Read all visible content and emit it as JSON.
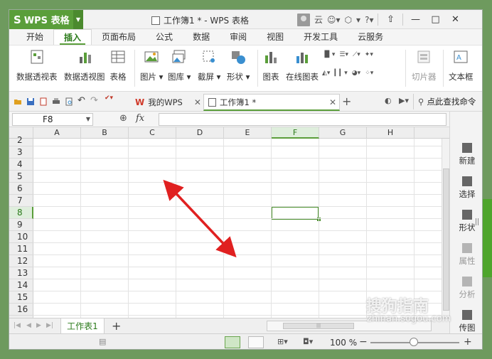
{
  "app": {
    "name": "WPS 表格",
    "logo": "S"
  },
  "window": {
    "title": "工作簿1 * - WPS 表格",
    "user_label": "云"
  },
  "ribbon_tabs": [
    "开始",
    "插入",
    "页面布局",
    "公式",
    "数据",
    "审阅",
    "视图",
    "开发工具",
    "云服务"
  ],
  "active_tab": "插入",
  "ribbon": {
    "pivot_table": "数据透视表",
    "pivot_chart": "数据透视图",
    "table": "表格",
    "picture": "图片",
    "gallery": "图库",
    "screenshot": "截屏",
    "shape": "形状",
    "chart": "图表",
    "online_chart": "在线图表",
    "slicer": "切片器",
    "textbox": "文本框"
  },
  "doc_tabs": {
    "home": "我的WPS",
    "workbook": "工作簿1 *"
  },
  "search": {
    "label": "点此查找命令"
  },
  "formula": {
    "cell_ref": "F8",
    "fx": "fx",
    "value": ""
  },
  "columns": [
    "A",
    "B",
    "C",
    "D",
    "E",
    "F",
    "G",
    "H"
  ],
  "rows": [
    "2",
    "3",
    "4",
    "5",
    "6",
    "7",
    "8",
    "9",
    "10",
    "11",
    "12",
    "13",
    "14",
    "15",
    "16"
  ],
  "selected": {
    "column": "F",
    "row": "8"
  },
  "side_panel": [
    "新建",
    "选择",
    "形状",
    "属性",
    "分析",
    "传图"
  ],
  "sheets": [
    "工作表1"
  ],
  "status": {
    "zoom": "100 %",
    "minus": "−",
    "plus": "+"
  },
  "watermark": {
    "text": "搜狗指南",
    "url": "zhinan.sogou.com"
  },
  "colors": {
    "accent": "#5a9e3a",
    "arrow": "#e02020",
    "selection": "#4a8f2c"
  }
}
